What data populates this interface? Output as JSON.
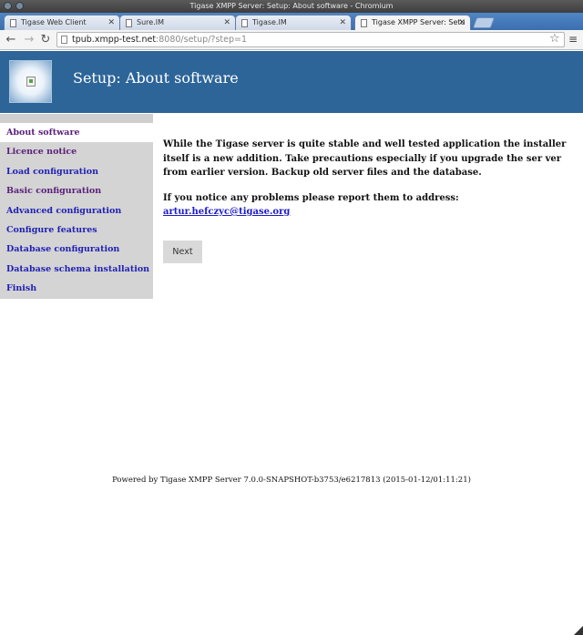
{
  "window": {
    "title": "Tigase XMPP Server: Setup: About software - Chromium"
  },
  "tabs": [
    {
      "label": "Tigase Web Client"
    },
    {
      "label": "Sure.IM"
    },
    {
      "label": "Tigase.IM"
    },
    {
      "label": "Tigase XMPP Server: Setu"
    }
  ],
  "address": {
    "host": "tpub.xmpp-test.net",
    "rest": ":8080/setup/?step=1"
  },
  "toolbar": {
    "back": "←",
    "forward": "→",
    "reload": "↻",
    "star": "☆",
    "menu": "≡"
  },
  "banner": {
    "title": "Setup: About software"
  },
  "sidebar": {
    "items": [
      {
        "label": "About software"
      },
      {
        "label": "Licence notice"
      },
      {
        "label": "Load configuration"
      },
      {
        "label": "Basic configuration"
      },
      {
        "label": "Advanced configuration"
      },
      {
        "label": "Configure features"
      },
      {
        "label": "Database configuration"
      },
      {
        "label": "Database schema installation"
      },
      {
        "label": "Finish"
      }
    ]
  },
  "main": {
    "intro": "While the Tigase server is quite stable and well tested application the installer itself is a new addition. Take precautions especially if you upgrade the ser ver from earlier version. Backup old server files and the database.",
    "report_text": "If you notice any problems please report them to address:",
    "report_email": "artur.hefczyc@tigase.org",
    "next_label": "Next"
  },
  "footer": {
    "text": "Powered by Tigase XMPP Server 7.0.0-SNAPSHOT-b3753/e6217813 (2015-01-12/01:11:21)"
  },
  "colors": {
    "banner": "#2d6599",
    "sidebar": "#d4d4d4",
    "link": "#1f1fb5",
    "visited": "#5a1e7a"
  }
}
